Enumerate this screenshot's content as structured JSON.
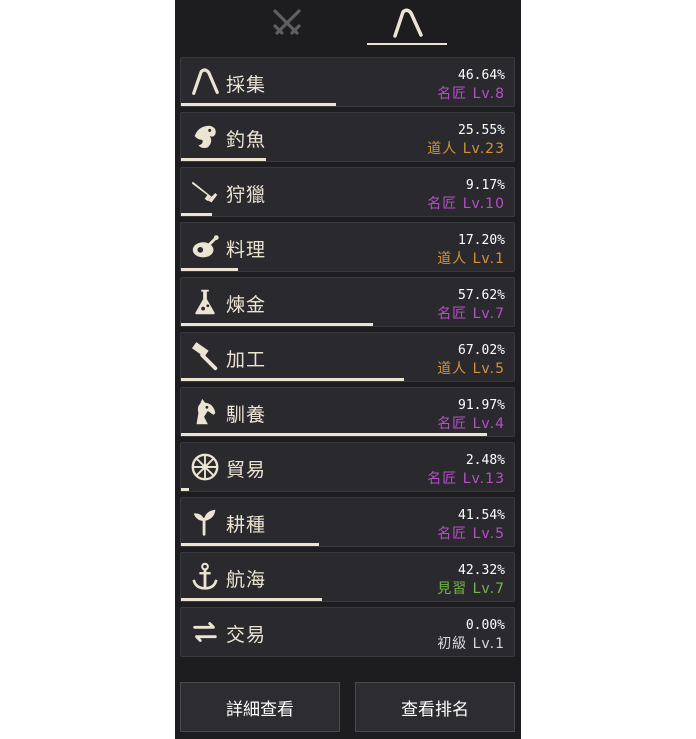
{
  "tabs": [
    {
      "icon": "crossed-swords-icon",
      "active": false
    },
    {
      "icon": "sickle-icon",
      "active": true
    }
  ],
  "colors": {
    "master": "#b64fc8",
    "artisan": "#d1923a",
    "apprentice": "#76b54a",
    "beginner": "#d8d8d8",
    "accent": "#ece4d2"
  },
  "skills": [
    {
      "name": "採集",
      "icon": "sickle-icon",
      "percent": "46.64%",
      "level": "名匠 Lv.8",
      "rank": "master",
      "progress": 0.4664
    },
    {
      "name": "釣魚",
      "icon": "fish-icon",
      "percent": "25.55%",
      "level": "道人 Lv.23",
      "rank": "artisan",
      "progress": 0.2555
    },
    {
      "name": "狩獵",
      "icon": "musket-icon",
      "percent": "9.17%",
      "level": "名匠 Lv.10",
      "rank": "master",
      "progress": 0.0917
    },
    {
      "name": "料理",
      "icon": "roast-chicken-icon",
      "percent": "17.20%",
      "level": "道人 Lv.1",
      "rank": "artisan",
      "progress": 0.172
    },
    {
      "name": "煉金",
      "icon": "flask-icon",
      "percent": "57.62%",
      "level": "名匠 Lv.7",
      "rank": "master",
      "progress": 0.5762
    },
    {
      "name": "加工",
      "icon": "hammer-icon",
      "percent": "67.02%",
      "level": "道人 Lv.5",
      "rank": "artisan",
      "progress": 0.6702
    },
    {
      "name": "馴養",
      "icon": "horse-head-icon",
      "percent": "91.97%",
      "level": "名匠 Lv.4",
      "rank": "master",
      "progress": 0.9197
    },
    {
      "name": "貿易",
      "icon": "wheel-icon",
      "percent": "2.48%",
      "level": "名匠 Lv.13",
      "rank": "master",
      "progress": 0.0248
    },
    {
      "name": "耕種",
      "icon": "sprout-icon",
      "percent": "41.54%",
      "level": "名匠 Lv.5",
      "rank": "master",
      "progress": 0.4154
    },
    {
      "name": "航海",
      "icon": "anchor-icon",
      "percent": "42.32%",
      "level": "見習 Lv.7",
      "rank": "apprentice",
      "progress": 0.4232
    },
    {
      "name": "交易",
      "icon": "exchange-arrows-icon",
      "percent": "0.00%",
      "level": "初級 Lv.1",
      "rank": "beginner",
      "progress": 0
    }
  ],
  "buttons": {
    "details": "詳細查看",
    "ranking": "查看排名"
  }
}
